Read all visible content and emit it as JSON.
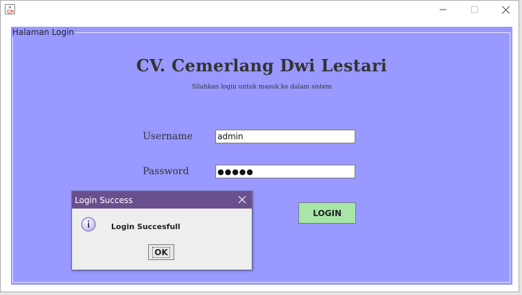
{
  "window": {
    "title": "",
    "icon": "java-cup-icon",
    "controls": {
      "minimize": "minimize-icon",
      "maximize": "maximize-icon",
      "close": "close-icon"
    }
  },
  "panel": {
    "border_title": "Halaman Login",
    "background": "#9999ff"
  },
  "header": {
    "company_name": "CV. Cemerlang Dwi Lestari",
    "subtitle": "Silahkan login untuk masuk ke dalam sistem"
  },
  "form": {
    "username_label": "Username",
    "username_value": "admin",
    "password_label": "Password",
    "password_value": "●●●●●",
    "login_button": "LOGIN",
    "login_button_color": "#a7e6a7"
  },
  "dialog": {
    "title": "Login Success",
    "title_bar_color": "#6a4f8f",
    "icon": "info-icon",
    "message": "Login Succesfull",
    "ok_button": "OK"
  }
}
